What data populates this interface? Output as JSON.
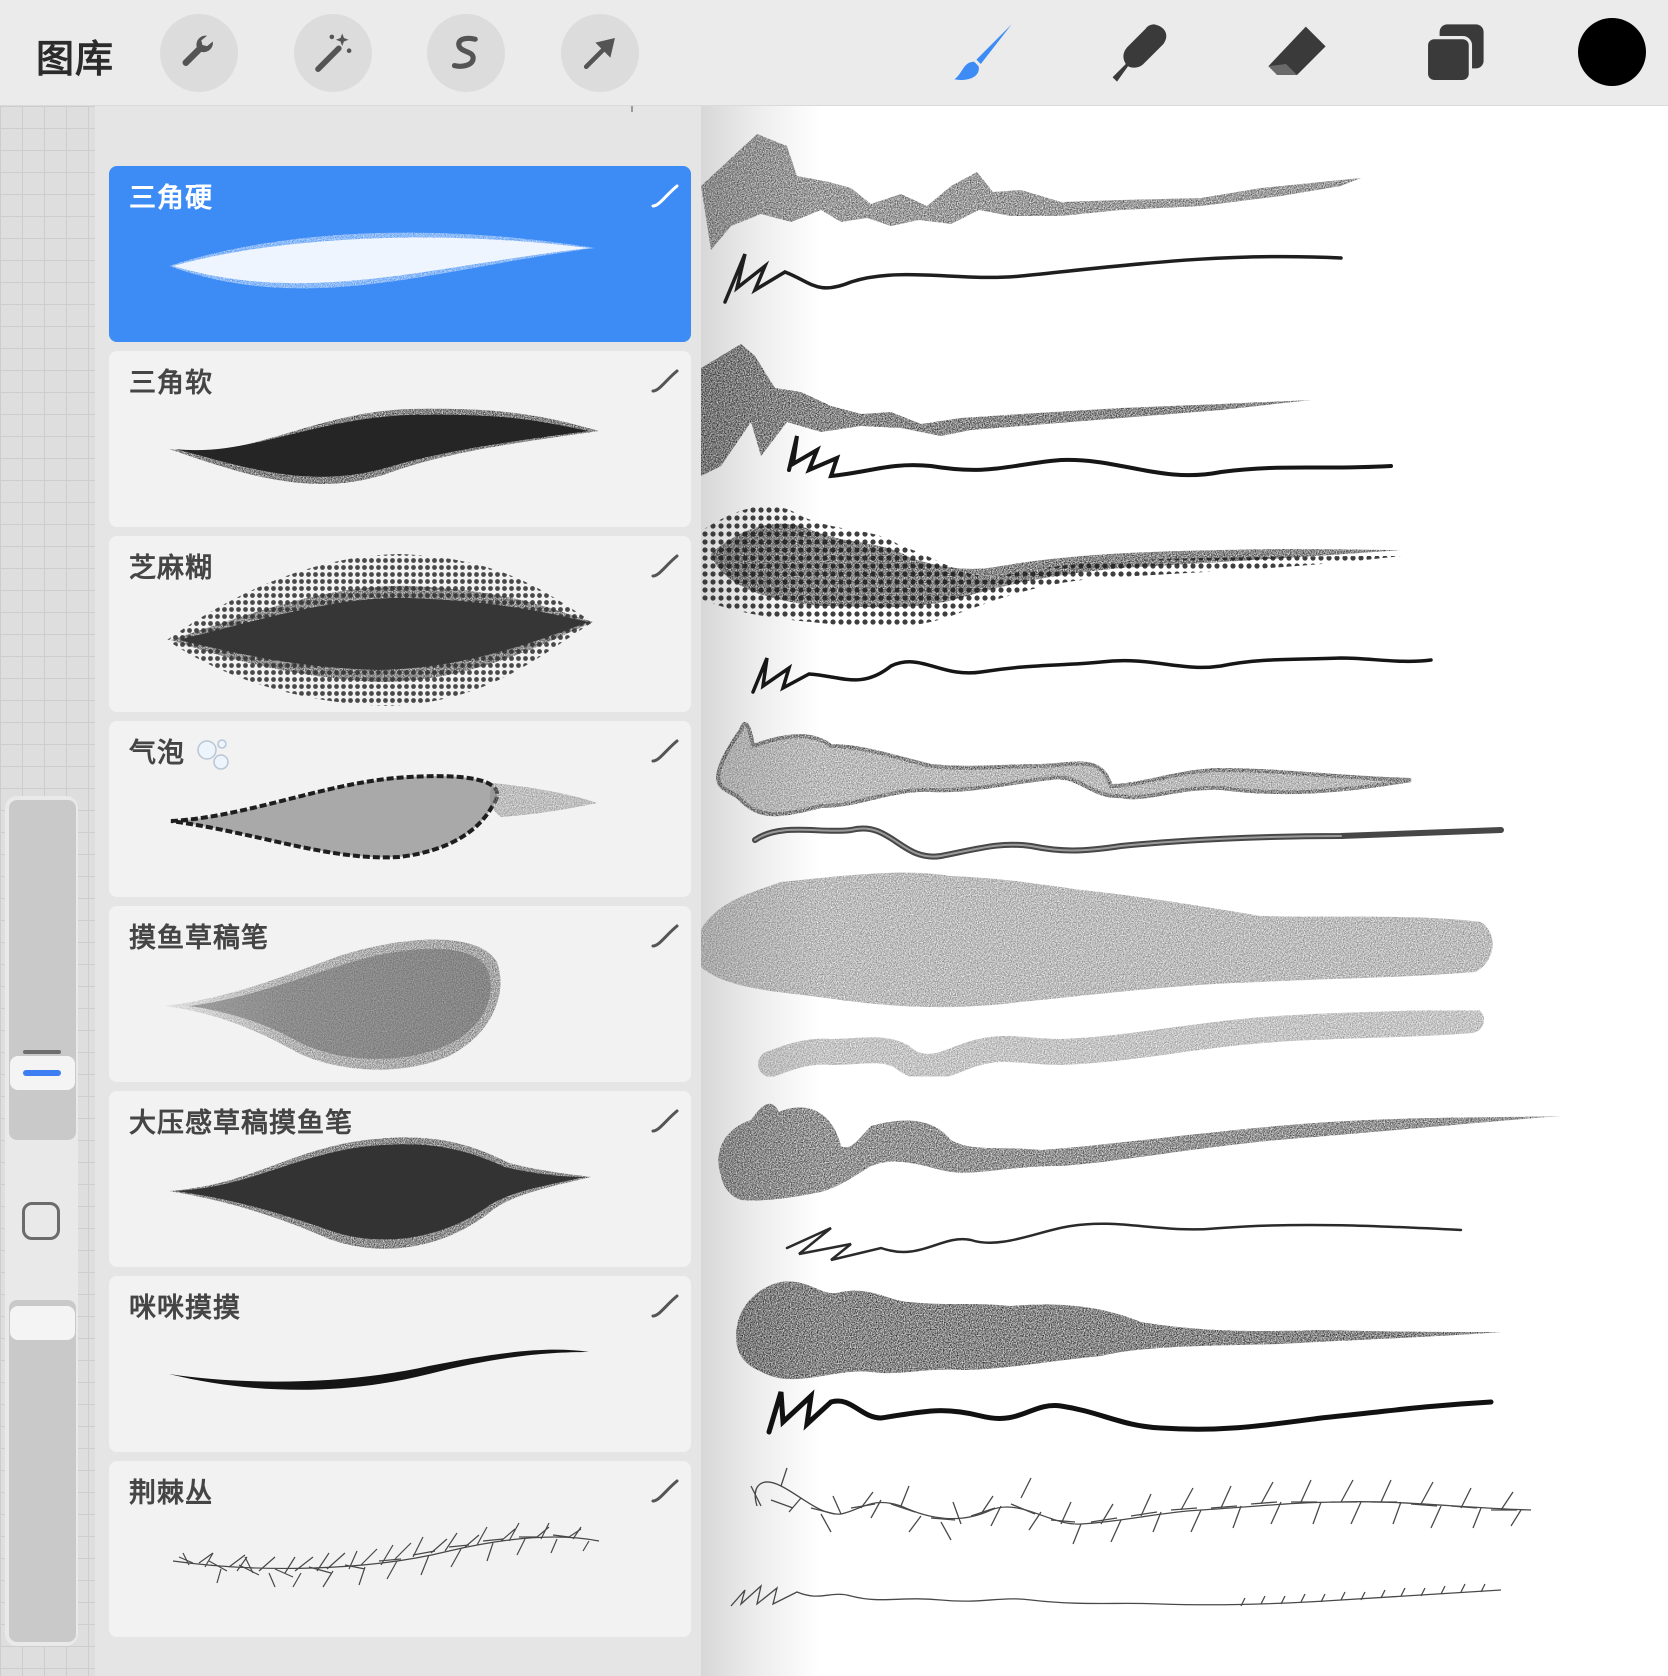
{
  "toolbar": {
    "gallery_label": "图库",
    "tools_left": [
      {
        "name": "actions",
        "icon": "wrench-icon"
      },
      {
        "name": "adjustments",
        "icon": "magic-wand-icon"
      },
      {
        "name": "selection",
        "icon": "selection-s-icon"
      },
      {
        "name": "transform",
        "icon": "arrow-cursor-icon"
      }
    ],
    "tools_right": [
      {
        "name": "paint",
        "icon": "brush-icon",
        "active": true
      },
      {
        "name": "smudge",
        "icon": "smudge-finger-icon"
      },
      {
        "name": "erase",
        "icon": "eraser-icon"
      },
      {
        "name": "layers",
        "icon": "layers-icon"
      }
    ],
    "current_color": "#000000",
    "accent_color": "#3d8bf5"
  },
  "brush_library": {
    "brushes": [
      {
        "name": "三角硬",
        "selected": true
      },
      {
        "name": "三角软",
        "selected": false
      },
      {
        "name": "芝麻糊",
        "selected": false
      },
      {
        "name": "气泡",
        "selected": false,
        "badge_icon": "bubbles-icon"
      },
      {
        "name": "摸鱼草稿笔",
        "selected": false
      },
      {
        "name": "大压感草稿摸鱼笔",
        "selected": false
      },
      {
        "name": "咪咪摸摸",
        "selected": false
      },
      {
        "name": "荆棘丛",
        "selected": false
      }
    ]
  }
}
